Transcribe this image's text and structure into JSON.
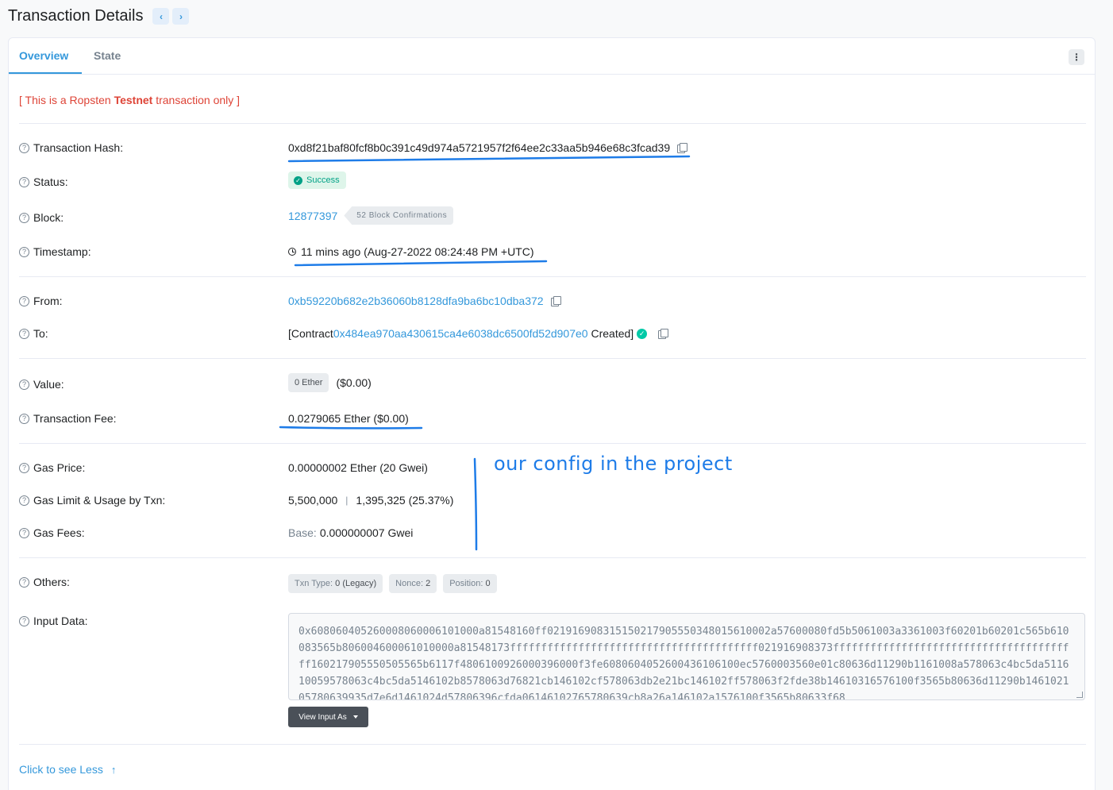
{
  "header": {
    "title": "Transaction Details",
    "prev_icon": "chevron-left-icon",
    "next_icon": "chevron-right-icon"
  },
  "tabs": [
    {
      "label": "Overview",
      "active": true
    },
    {
      "label": "State",
      "active": false
    }
  ],
  "testnet_notice": {
    "prefix": "[ This is a Ropsten ",
    "bold": "Testnet",
    "suffix": " transaction only ]"
  },
  "fields": {
    "tx_hash": {
      "label": "Transaction Hash:",
      "value": "0xd8f21baf80fcf8b0c391c49d974a5721957f2f64ee2c33aa5b946e68c3fcad39"
    },
    "status": {
      "label": "Status:",
      "value": "Success"
    },
    "block": {
      "label": "Block:",
      "value": "12877397",
      "confirmations": "52 Block Confirmations"
    },
    "timestamp": {
      "label": "Timestamp:",
      "value": "11 mins ago (Aug-27-2022 08:24:48 PM +UTC)"
    },
    "from": {
      "label": "From:",
      "value": "0xb59220b682e2b36060b8128dfa9ba6bc10dba372"
    },
    "to": {
      "label": "To:",
      "prefix": "[Contract ",
      "address": "0x484ea970aa430615ca4e6038dc6500fd52d907e0",
      "suffix": " Created]"
    },
    "value": {
      "label": "Value:",
      "amount": "0 Ether",
      "usd": "($0.00)"
    },
    "tx_fee": {
      "label": "Transaction Fee:",
      "value": "0.0279065 Ether ($0.00)"
    },
    "gas_price": {
      "label": "Gas Price:",
      "value": "0.00000002 Ether (20 Gwei)"
    },
    "gas_limit": {
      "label": "Gas Limit & Usage by Txn:",
      "limit": "5,500,000",
      "separator": "|",
      "usage": "1,395,325 (25.37%)"
    },
    "gas_fees": {
      "label": "Gas Fees:",
      "base_label": "Base:",
      "base_value": "0.000000007 Gwei"
    },
    "others": {
      "label": "Others:",
      "badges": [
        {
          "key": "Txn Type:",
          "val": "0 (Legacy)"
        },
        {
          "key": "Nonce:",
          "val": "2"
        },
        {
          "key": "Position:",
          "val": "0"
        }
      ]
    },
    "input_data": {
      "label": "Input Data:",
      "value": "0x608060405260008060006101000a81548160ff021916908315150217905550348015610002a57600080fd5b5061003a3361003f60201b60201c565b610083565b806004600061010000a81548173ffffffffffffffffffffffffffffffffffffffff021916908373ffffffffffffffffffffffffffffffffffffffff160217905550505565b6117f4806100926000396000f3fe6080604052600436106100ec5760003560e01c80636d11290b1161008a578063c4bc5da511610059578063c4bc5da5146102b8578063d76821cb146102cf578063db2e21bc146102ff578063f2fde38b14610316576100f3565b80636d11290b146102105780639935d7e6d1461024d57806396cfda06146102765780639cb8a26a146102a1576100f3565b80633f68",
      "button_label": "View Input As"
    }
  },
  "footer": {
    "see_less": "Click to see Less"
  },
  "annotation": {
    "text": "our config in the project"
  },
  "colors": {
    "link": "#3498db",
    "success": "#00a186",
    "testnet": "#de4437",
    "annotation": "#1e7ce8"
  }
}
